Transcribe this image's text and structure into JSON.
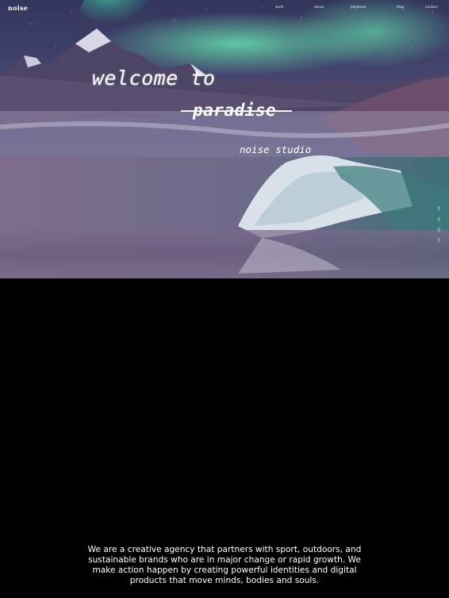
{
  "header": {
    "logo": "noise",
    "nav": [
      "work",
      "about",
      "playbook",
      "blog",
      "contact"
    ]
  },
  "hero": {
    "headline": "welcome to",
    "struck_word": "paradise",
    "studio_name": "noise studio",
    "language_switcher": [
      "SE",
      "DK",
      "NO",
      "FR"
    ]
  },
  "intro": {
    "text": "We are a creative agency that partners with sport, outdoors, and sustainable brands who are in major change or rapid growth. We make action happen by creating powerful identities and digital products that move minds, bodies and souls."
  },
  "colors": {
    "background": "#000000",
    "aurora": "#52d6a3",
    "text": "#ffffff"
  }
}
